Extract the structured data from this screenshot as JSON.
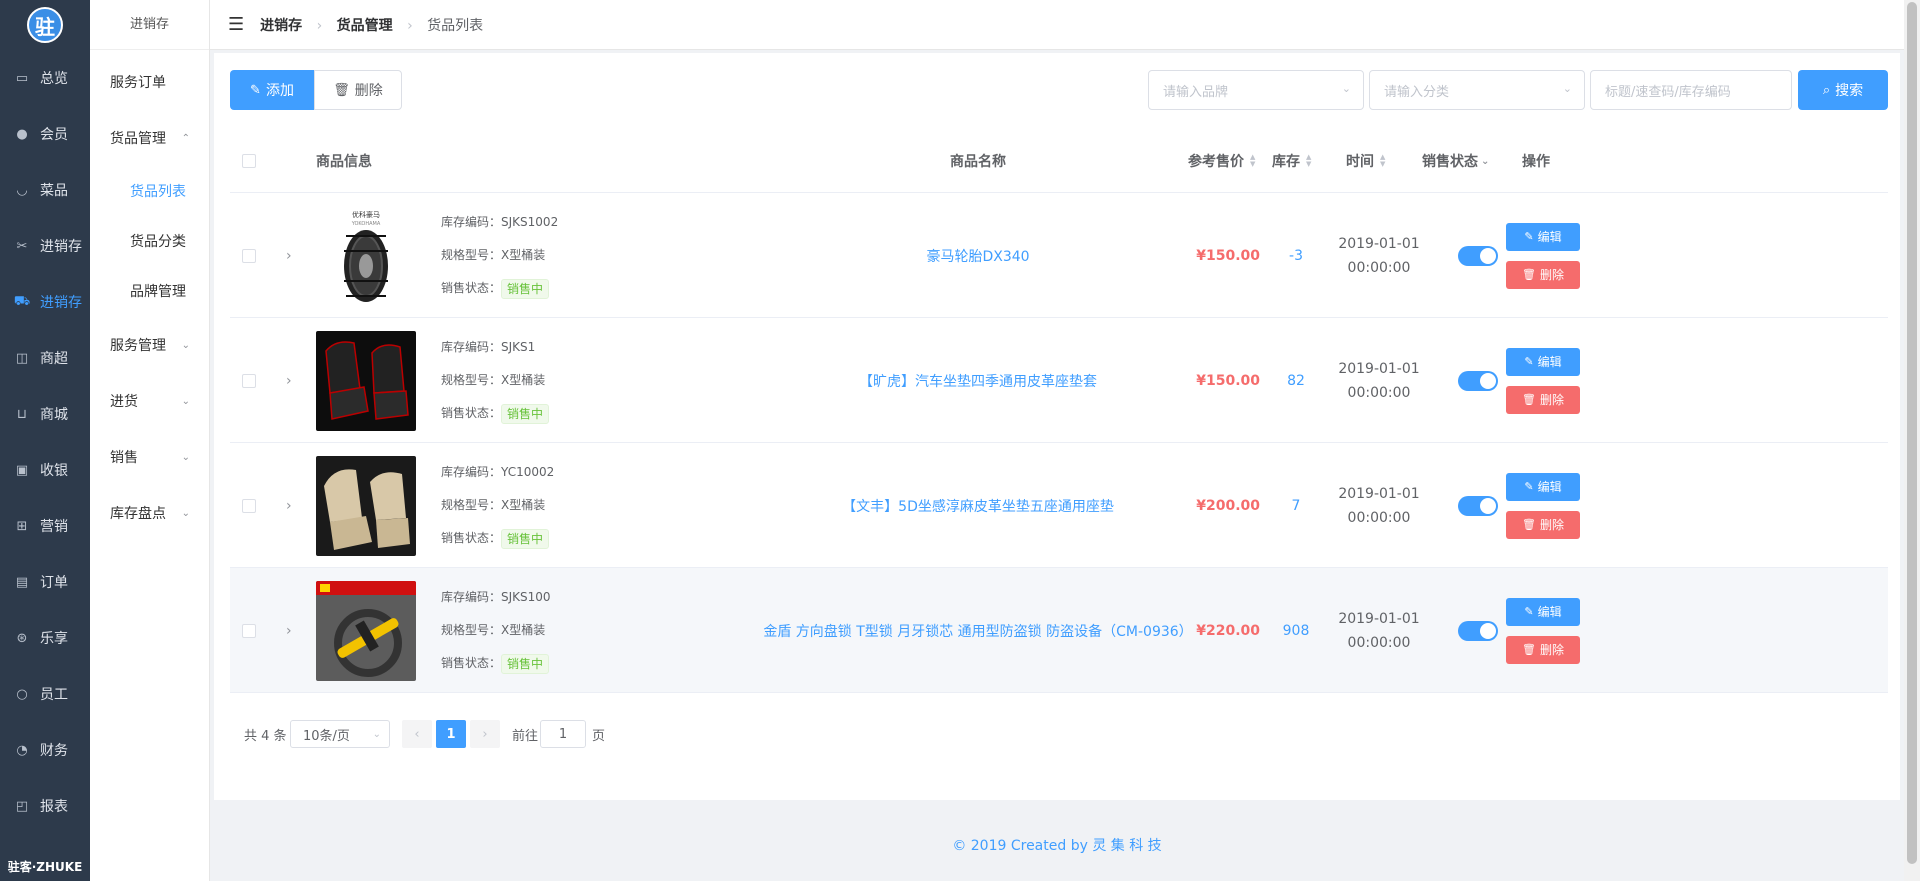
{
  "app": {
    "logo_char": "驻",
    "brand": "驻客·ZHUKE"
  },
  "rail": [
    {
      "label": "总览",
      "icon": "monitor-icon",
      "glyph": "▭"
    },
    {
      "label": "会员",
      "icon": "user-icon",
      "glyph": "●"
    },
    {
      "label": "菜品",
      "icon": "bowl-icon",
      "glyph": "◡"
    },
    {
      "label": "进销存",
      "icon": "scissors-icon",
      "glyph": "✂"
    },
    {
      "label": "进销存",
      "icon": "truck-icon",
      "glyph": "⛟",
      "active": true
    },
    {
      "label": "商超",
      "icon": "bag-icon",
      "glyph": "◫"
    },
    {
      "label": "商城",
      "icon": "cart-icon",
      "glyph": "⊔"
    },
    {
      "label": "收银",
      "icon": "cash-icon",
      "glyph": "▣"
    },
    {
      "label": "营销",
      "icon": "gift-icon",
      "glyph": "⊞"
    },
    {
      "label": "订单",
      "icon": "document-icon",
      "glyph": "▤"
    },
    {
      "label": "乐享",
      "icon": "share-icon",
      "glyph": "⊛"
    },
    {
      "label": "员工",
      "icon": "person-icon",
      "glyph": "○"
    },
    {
      "label": "财务",
      "icon": "pie-chart-icon",
      "glyph": "◔"
    },
    {
      "label": "报表",
      "icon": "chart-icon",
      "glyph": "◰"
    }
  ],
  "submenu": {
    "title": "进销存",
    "items": [
      {
        "label": "服务订单",
        "type": "item"
      },
      {
        "label": "货品管理",
        "type": "group",
        "arrow": "⌃"
      },
      {
        "label": "货品列表",
        "type": "child",
        "active": true
      },
      {
        "label": "货品分类",
        "type": "child"
      },
      {
        "label": "品牌管理",
        "type": "child"
      },
      {
        "label": "服务管理",
        "type": "group",
        "arrow": "⌄"
      },
      {
        "label": "进货",
        "type": "group",
        "arrow": "⌄"
      },
      {
        "label": "销售",
        "type": "group",
        "arrow": "⌄"
      },
      {
        "label": "库存盘点",
        "type": "group",
        "arrow": "⌄"
      }
    ]
  },
  "breadcrumb": {
    "b1": "进销存",
    "b2": "货品管理",
    "b3": "货品列表"
  },
  "toolbar": {
    "add_label": "添加",
    "delete_label": "删除",
    "brand_placeholder": "请输入品牌",
    "category_placeholder": "请输入分类",
    "search_placeholder": "标题/速查码/库存编码",
    "search_label": "搜索"
  },
  "table": {
    "headers": {
      "info": "商品信息",
      "name": "商品名称",
      "price": "参考售价",
      "stock": "库存",
      "time": "时间",
      "status": "销售状态",
      "ops": "操作"
    },
    "labels": {
      "code": "库存编码：",
      "spec": "规格型号：",
      "sale": "销售状态："
    },
    "rows": [
      {
        "code": "SJKS1002",
        "spec": "X型桶装",
        "sale_tag": "销售中",
        "name": "豪马轮胎DX340",
        "price": "¥150.00",
        "stock": "-3",
        "date": "2019-01-01",
        "clock": "00:00:00",
        "image": "tire"
      },
      {
        "code": "SJKS1",
        "spec": "X型桶装",
        "sale_tag": "销售中",
        "name": "【旷虎】汽车坐垫四季通用皮革座垫套",
        "price": "¥150.00",
        "stock": "82",
        "date": "2019-01-01",
        "clock": "00:00:00",
        "image": "seat-black"
      },
      {
        "code": "YC10002",
        "spec": "X型桶装",
        "sale_tag": "销售中",
        "name": "【文丰】5D坐感淳麻皮革坐垫五座通用座垫",
        "price": "¥200.00",
        "stock": "7",
        "date": "2019-01-01",
        "clock": "00:00:00",
        "image": "seat-beige"
      },
      {
        "code": "SJKS100",
        "spec": "X型桶装",
        "sale_tag": "销售中",
        "name": "金盾 方向盘锁 T型锁 月牙锁芯 通用型防盗锁 防盗设备（CM-0936）",
        "price": "¥220.00",
        "stock": "908",
        "date": "2019-01-01",
        "clock": "00:00:00",
        "image": "lock"
      }
    ],
    "edit_label": "编辑",
    "delete_label": "删除"
  },
  "tire_caption": {
    "line1": "优科豪马",
    "line2": "YOKOHAMA"
  },
  "pagination": {
    "total": "共 4 条",
    "page_size": "10条/页",
    "prev": "‹",
    "current": "1",
    "next": "›",
    "goto": "前往",
    "goto_value": "1",
    "page_unit": "页"
  },
  "footer": "© 2019 Created by 灵 集 科 技",
  "colors": {
    "primary": "#409eff",
    "danger": "#f56c6c",
    "success": "#67c23a",
    "rail_bg": "#2d3a4b"
  }
}
